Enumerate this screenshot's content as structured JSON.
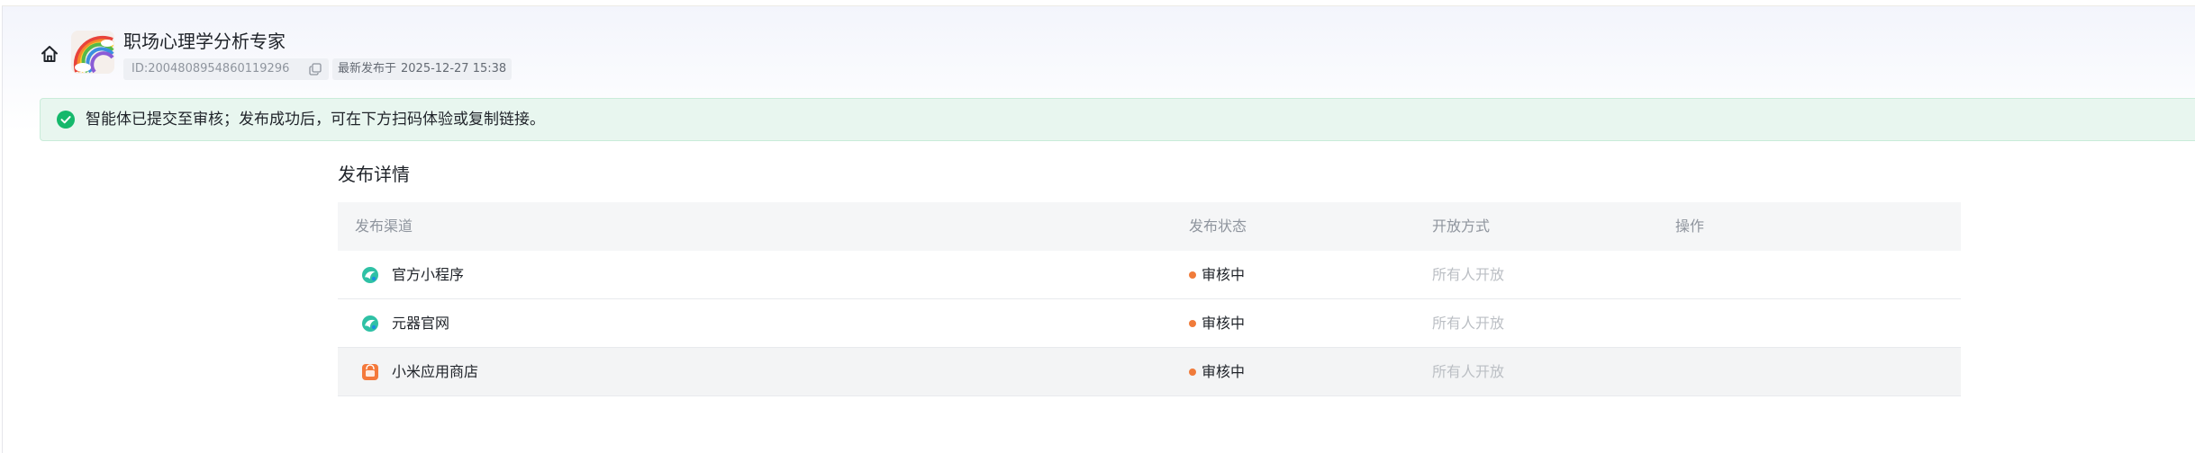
{
  "header": {
    "agent_title": "职场心理学分析专家",
    "id_text": "ID:2004808954860119296",
    "published_label": "最新发布于",
    "published_time": "2025-12-27 15:38"
  },
  "alert": {
    "text": "智能体已提交至审核；发布成功后，可在下方扫码体验或复制链接。",
    "color": "#15b86b"
  },
  "section": {
    "title": "发布详情"
  },
  "table": {
    "columns": [
      "发布渠道",
      "发布状态",
      "开放方式",
      "操作"
    ],
    "rows": [
      {
        "channel": "官方小程序",
        "icon": "miniprogram-icon",
        "status": "审核中",
        "access": "所有人开放"
      },
      {
        "channel": "元器官网",
        "icon": "yuanqi-site-icon",
        "status": "审核中",
        "access": "所有人开放"
      },
      {
        "channel": "小米应用商店",
        "icon": "xiaomi-store-icon",
        "status": "审核中",
        "access": "所有人开放"
      }
    ]
  },
  "colors": {
    "status_pending": "#f07b3a",
    "alert_bg": "#e8f6ef",
    "muted_text": "#bbbfc4"
  }
}
